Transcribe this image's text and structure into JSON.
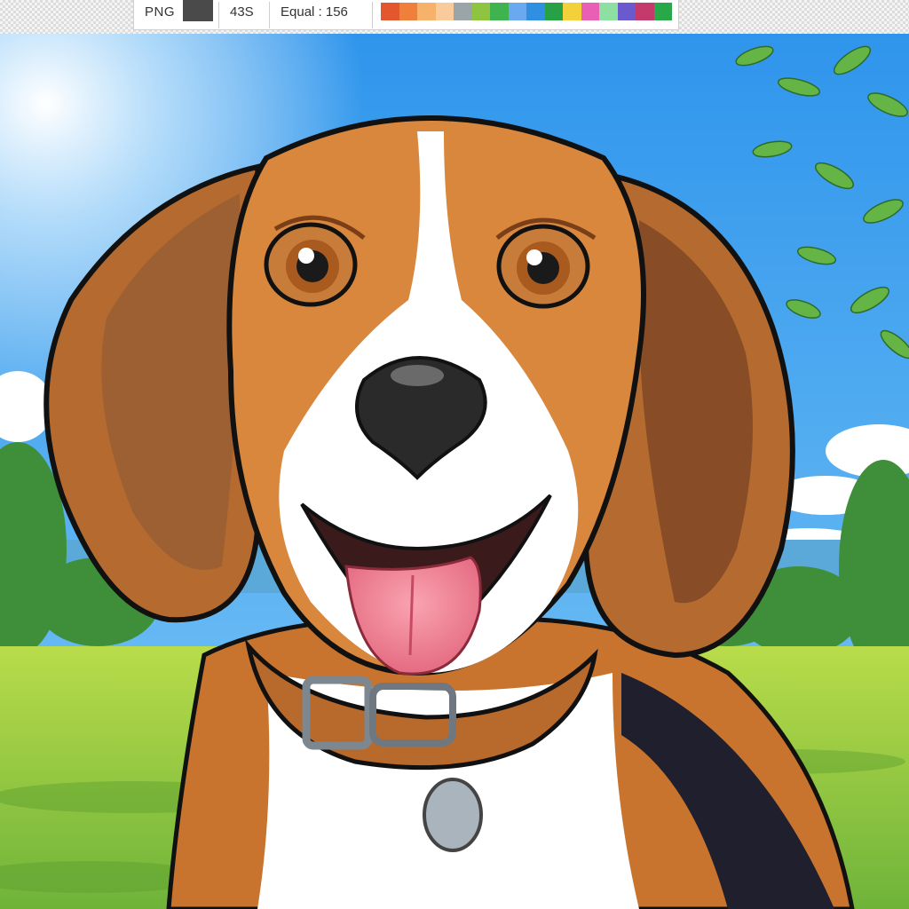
{
  "toolbar": {
    "format_label": "PNG",
    "swatch_color": "#4a4a4a",
    "count_label": "43S",
    "mode_label": "Equal : 156",
    "palette": [
      "#e4572e",
      "#f07f3c",
      "#f6b26b",
      "#f9cb9c",
      "#9aa5a8",
      "#8fc440",
      "#3fb34f",
      "#6aa8f0",
      "#2f8fe0",
      "#27a046",
      "#f2d13a",
      "#e85fb5",
      "#8ee0a2",
      "#6a5acd",
      "#c43a6b",
      "#29a84a"
    ]
  },
  "artwork": {
    "subject": "beagle",
    "collar_color": "#b8692c",
    "sky_color": "#3ea2ef",
    "grass_color": "#8cc63f"
  }
}
